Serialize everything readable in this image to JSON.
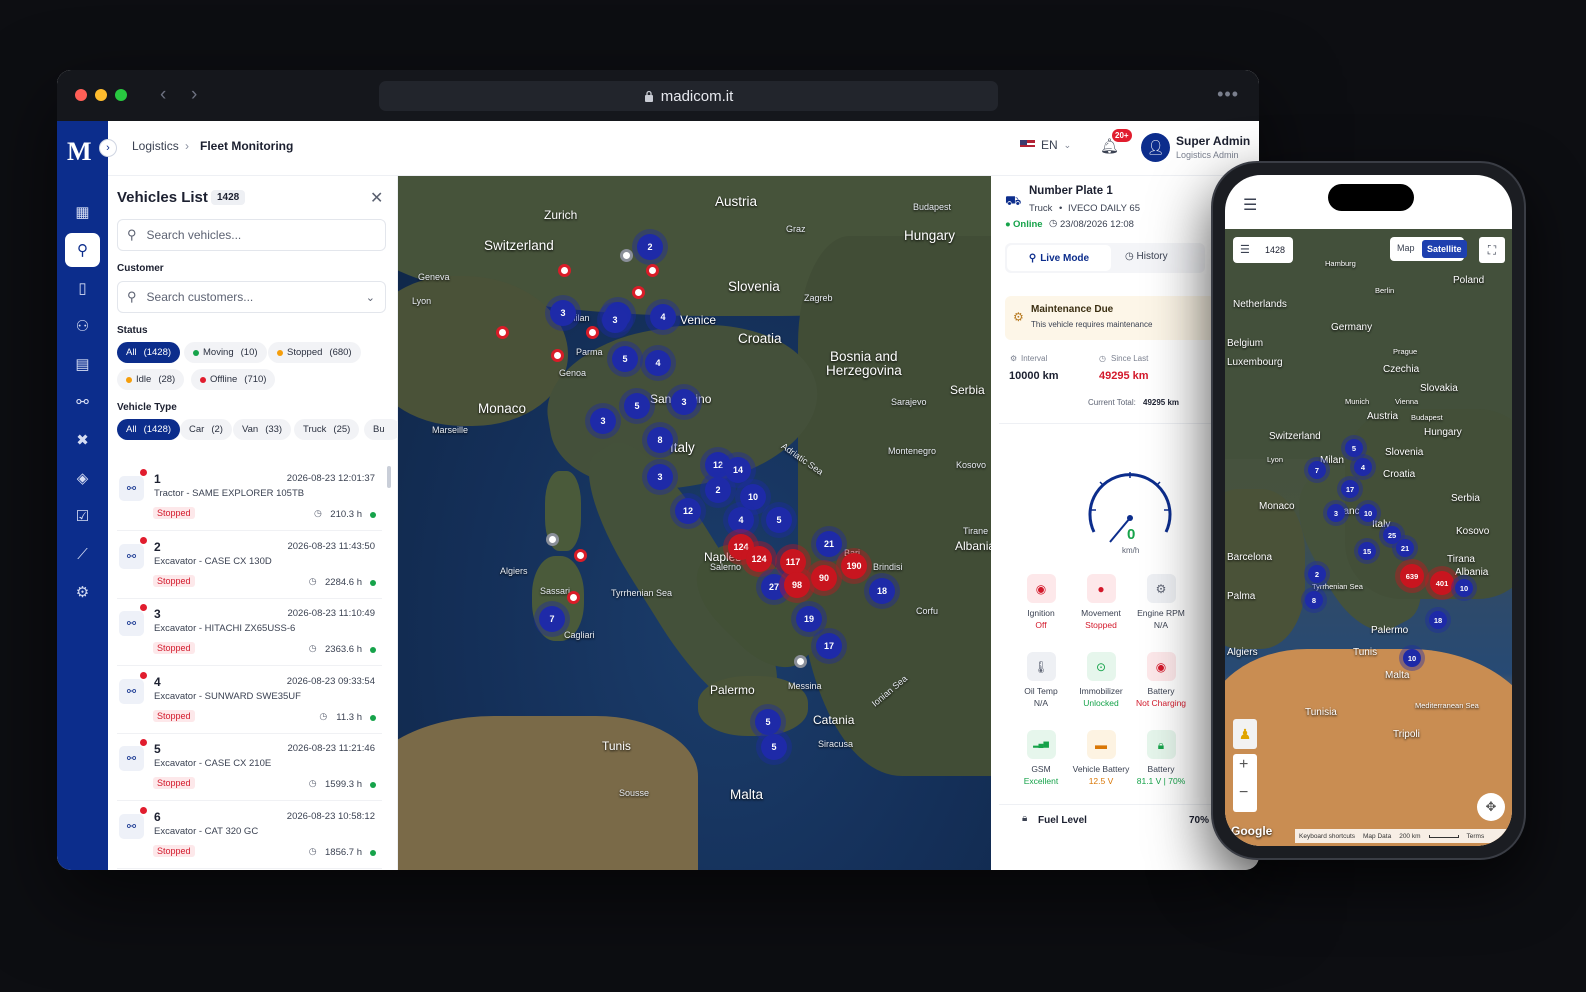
{
  "browser": {
    "url": "madicom.it"
  },
  "brand": {
    "logo": "M",
    "accent": "#0c2d8c",
    "danger": "#d3192b",
    "success": "#16a34a"
  },
  "header": {
    "breadcrumb": [
      "Logistics",
      "Fleet Monitoring"
    ],
    "lang": "EN",
    "notif_badge": "20+",
    "user_name": "Super Admin",
    "user_role": "Logistics Admin"
  },
  "rail": {
    "icons": [
      "dashboard-icon",
      "map-pin-icon",
      "tablet-icon",
      "users-icon",
      "document-icon",
      "route-icon",
      "tools-icon",
      "layers-icon",
      "calendar-check-icon",
      "chart-icon",
      "settings-icon"
    ]
  },
  "vehicles": {
    "title": "Vehicles List",
    "count": "1428",
    "search_placeholder": "Search vehicles...",
    "customer_label": "Customer",
    "customer_placeholder": "Search customers...",
    "status_label": "Status",
    "status_chips": [
      {
        "label": "All",
        "count": "(1428)",
        "color": ""
      },
      {
        "label": "Moving",
        "count": "(10)",
        "color": "#16a34a"
      },
      {
        "label": "Stopped",
        "count": "(680)",
        "color": "#f59e0b"
      },
      {
        "label": "Idle",
        "count": "(28)",
        "color": "#f59e0b"
      },
      {
        "label": "Offline",
        "count": "(710)",
        "color": "#e11d2e"
      }
    ],
    "type_label": "Vehicle Type",
    "type_chips": [
      {
        "label": "All",
        "count": "(1428)"
      },
      {
        "label": "Car",
        "count": "(2)"
      },
      {
        "label": "Van",
        "count": "(33)"
      },
      {
        "label": "Truck",
        "count": "(25)"
      },
      {
        "label": "Bu",
        "count": ""
      }
    ],
    "items": [
      {
        "num": "1",
        "time": "2026-08-23 12:01:37",
        "desc": "Tractor - SAME EXPLORER 105TB",
        "status": "Stopped",
        "hours": "210.3 h"
      },
      {
        "num": "2",
        "time": "2026-08-23 11:43:50",
        "desc": "Excavator - CASE CX 130D",
        "status": "Stopped",
        "hours": "2284.6 h"
      },
      {
        "num": "3",
        "time": "2026-08-23 11:10:49",
        "desc": "Excavator - HITACHI ZX65USS-6",
        "status": "Stopped",
        "hours": "2363.6 h"
      },
      {
        "num": "4",
        "time": "2026-08-23 09:33:54",
        "desc": "Excavator - SUNWARD SWE35UF",
        "status": "Stopped",
        "hours": "11.3 h"
      },
      {
        "num": "5",
        "time": "2026-08-23 11:21:46",
        "desc": "Excavator - CASE CX 210E",
        "status": "Stopped",
        "hours": "1599.3 h"
      },
      {
        "num": "6",
        "time": "2026-08-23 10:58:12",
        "desc": "Excavator - CAT 320 GC",
        "status": "Stopped",
        "hours": "1856.7 h"
      }
    ]
  },
  "map": {
    "labels": [
      "Austria",
      "Switzerland",
      "Zurich",
      "Geneva",
      "Lyon",
      "Graz",
      "Budapest",
      "Hungary",
      "Slovenia",
      "Zagreb",
      "Croatia",
      "Venice",
      "Milan",
      "Genoa",
      "Parma",
      "Monaco",
      "Marseille",
      "Bosnia and",
      "Herzegovina",
      "Serbia",
      "Sarajevo",
      "Montenegro",
      "Kosovo",
      "San Marino",
      "Italy",
      "Naples",
      "Salerno",
      "Bari",
      "Brindisi",
      "Tyrrhenian Sea",
      "Cagliari",
      "Sassari",
      "Algiers",
      "Palermo",
      "Messina",
      "Catania",
      "Siracusa",
      "Tunis",
      "Sousse",
      "Malta",
      "Ionian Sea",
      "Adriatic Sea",
      "Albania",
      "Tirane",
      "Corfu"
    ],
    "clusters": [
      {
        "v": "2",
        "c": "b"
      },
      {
        "v": "3",
        "c": "b"
      },
      {
        "v": "2",
        "c": "b"
      },
      {
        "v": "3",
        "c": "b"
      },
      {
        "v": "4",
        "c": "b"
      },
      {
        "v": "5",
        "c": "b"
      },
      {
        "v": "4",
        "c": "b"
      },
      {
        "v": "5",
        "c": "b"
      },
      {
        "v": "3",
        "c": "b"
      },
      {
        "v": "3",
        "c": "b"
      },
      {
        "v": "8",
        "c": "b"
      },
      {
        "v": "3",
        "c": "b"
      },
      {
        "v": "12",
        "c": "b"
      },
      {
        "v": "14",
        "c": "b"
      },
      {
        "v": "2",
        "c": "b"
      },
      {
        "v": "10",
        "c": "b"
      },
      {
        "v": "12",
        "c": "b"
      },
      {
        "v": "4",
        "c": "b"
      },
      {
        "v": "5",
        "c": "b"
      },
      {
        "v": "124",
        "c": "r"
      },
      {
        "v": "124",
        "c": "r"
      },
      {
        "v": "117",
        "c": "r"
      },
      {
        "v": "21",
        "c": "b"
      },
      {
        "v": "190",
        "c": "r"
      },
      {
        "v": "27",
        "c": "b"
      },
      {
        "v": "98",
        "c": "r"
      },
      {
        "v": "90",
        "c": "r"
      },
      {
        "v": "18",
        "c": "b"
      },
      {
        "v": "7",
        "c": "b"
      },
      {
        "v": "19",
        "c": "b"
      },
      {
        "v": "17",
        "c": "b"
      },
      {
        "v": "5",
        "c": "b"
      },
      {
        "v": "5",
        "c": "b"
      }
    ]
  },
  "detail": {
    "plate": "Number Plate 1",
    "type": "Truck",
    "model": "IVECO DAILY 65",
    "online": "Online",
    "time": "23/08/2026 12:08",
    "tab_live": "Live Mode",
    "tab_history": "History",
    "maint_title": "Maintenance Due",
    "maint_desc": "This vehicle requires maintenance",
    "interval_label": "Interval",
    "interval_value": "10000 km",
    "since_label": "Since Last",
    "since_value": "49295 km",
    "current_total": "Current Total:",
    "current_total_value": "49295 km",
    "speed": "0",
    "speed_unit": "km/h",
    "sensors": [
      {
        "name": "Ignition",
        "value": "Off",
        "value_color": "#d3192b",
        "icon": "ignition-icon"
      },
      {
        "name": "Movement",
        "value": "Stopped",
        "value_color": "#d3192b",
        "icon": "movement-icon"
      },
      {
        "name": "Engine RPM",
        "value": "N/A",
        "value_color": "#3b4252",
        "icon": "engine-icon"
      },
      {
        "name": "Oil Temp",
        "value": "N/A",
        "value_color": "#3b4252",
        "icon": "oil-temp-icon"
      },
      {
        "name": "Immobilizer",
        "value": "Unlocked",
        "value_color": "#16a34a",
        "icon": "immobilizer-icon"
      },
      {
        "name": "Battery",
        "value": "Not Charging",
        "value_color": "#d3192b",
        "icon": "battery-charging-icon"
      },
      {
        "name": "GSM",
        "value": "Excellent",
        "value_color": "#16a34a",
        "icon": "signal-icon"
      },
      {
        "name": "Vehicle Battery",
        "value": "12.5 V",
        "value_color": "#d97706",
        "icon": "vehicle-battery-icon"
      },
      {
        "name": "Battery",
        "value": "81.1 V | 70%",
        "value_color": "#16a34a",
        "icon": "battery-lock-icon"
      }
    ],
    "fuel_label": "Fuel Level",
    "fuel_value": "70%"
  },
  "phone": {
    "count": "1428",
    "map_btn": "Map",
    "sat_btn": "Satellite",
    "labels": [
      "Hamburg",
      "Poland",
      "Berlin",
      "Netherlands",
      "Germany",
      "Belgium",
      "Luxembourg",
      "Prague",
      "Czechia",
      "Slovakia",
      "Munich",
      "Vienna",
      "Austria",
      "Budapest",
      "Hungary",
      "Switzerland",
      "Lyon",
      "Milan",
      "Slovenia",
      "Croatia",
      "Monaco",
      "France",
      "Italy",
      "Serbia",
      "Kosovo",
      "Barcelona",
      "Tirana",
      "Albania",
      "Tyrrhenian Sea",
      "Palma",
      "Algiers",
      "Tunis",
      "Palermo",
      "Malta",
      "Mediterranean Sea",
      "Tunisia",
      "Tripoli"
    ],
    "clusters": [
      {
        "v": "5",
        "c": "b"
      },
      {
        "v": "7",
        "c": "b"
      },
      {
        "v": "4",
        "c": "b"
      },
      {
        "v": "17",
        "c": "b"
      },
      {
        "v": "3",
        "c": "b"
      },
      {
        "v": "10",
        "c": "b"
      },
      {
        "v": "25",
        "c": "b"
      },
      {
        "v": "15",
        "c": "b"
      },
      {
        "v": "21",
        "c": "b"
      },
      {
        "v": "2",
        "c": "b"
      },
      {
        "v": "639",
        "c": "r"
      },
      {
        "v": "401",
        "c": "r"
      },
      {
        "v": "10",
        "c": "b"
      },
      {
        "v": "8",
        "c": "b"
      },
      {
        "v": "18",
        "c": "b"
      },
      {
        "v": "10",
        "c": "b"
      }
    ],
    "google": "Google",
    "footer": [
      "Keyboard shortcuts",
      "Map Data",
      "200 km",
      "Terms"
    ]
  }
}
